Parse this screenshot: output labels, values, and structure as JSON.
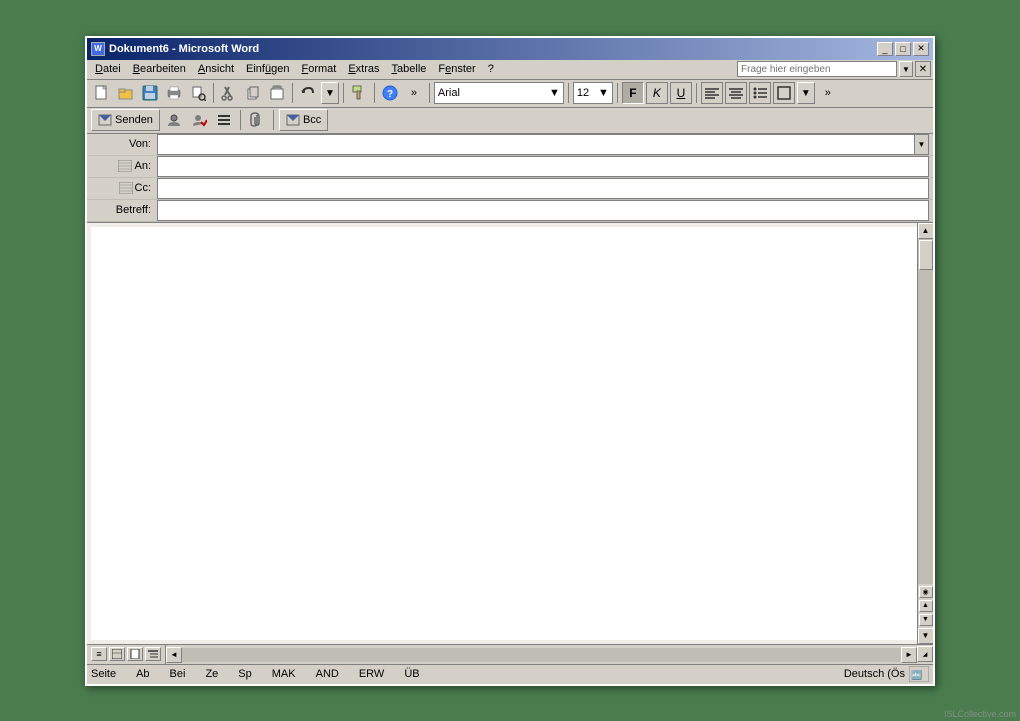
{
  "window": {
    "title": "Dokument6 - Microsoft Word",
    "icon": "W"
  },
  "title_buttons": {
    "minimize": "_",
    "restore": "□",
    "close": "✕"
  },
  "menu": {
    "items": [
      {
        "label": "Datei",
        "underline_index": 0
      },
      {
        "label": "Bearbeiten",
        "underline_index": 0
      },
      {
        "label": "Ansicht",
        "underline_index": 0
      },
      {
        "label": "Einfügen",
        "underline_index": 0
      },
      {
        "label": "Format",
        "underline_index": 0
      },
      {
        "label": "Extras",
        "underline_index": 0
      },
      {
        "label": "Tabelle",
        "underline_index": 0
      },
      {
        "label": "Fenster",
        "underline_index": 0
      },
      {
        "label": "?",
        "underline_index": -1
      }
    ],
    "help_placeholder": "Frage hier eingeben"
  },
  "toolbar1": {
    "buttons": [
      "📄",
      "📂",
      "💾",
      "🖨",
      "👁",
      "✂",
      "📋",
      "📋",
      "↩",
      "▼",
      "🔍",
      "?",
      "»"
    ]
  },
  "toolbar2_format": {
    "font": "Arial",
    "size": "12",
    "bold": "F",
    "italic": "K",
    "underline": "U",
    "align_left": "≡",
    "align_center": "≡",
    "bullets": "≡",
    "border": "□"
  },
  "email_toolbar": {
    "send_label": "Senden",
    "bcc_label": "Bcc"
  },
  "email_fields": {
    "von_label": "Von:",
    "an_label": "An:",
    "cc_label": "Cc:",
    "betreff_label": "Betreff:",
    "von_icon": "📋",
    "an_icon": "📋",
    "cc_icon": "📋"
  },
  "status_bar": {
    "seite_label": "Seite",
    "seite_value": "",
    "ab_label": "Ab",
    "ab_value": "",
    "bei_label": "Bei",
    "bei_value": "",
    "ze_label": "Ze",
    "ze_value": "",
    "sp_label": "Sp",
    "sp_value": "",
    "mak_label": "MAK",
    "and_label": "AND",
    "erw_label": "ERW",
    "ub_label": "ÜB",
    "language": "Deutsch (Ös",
    "watermark": "ISLCollective.com"
  }
}
